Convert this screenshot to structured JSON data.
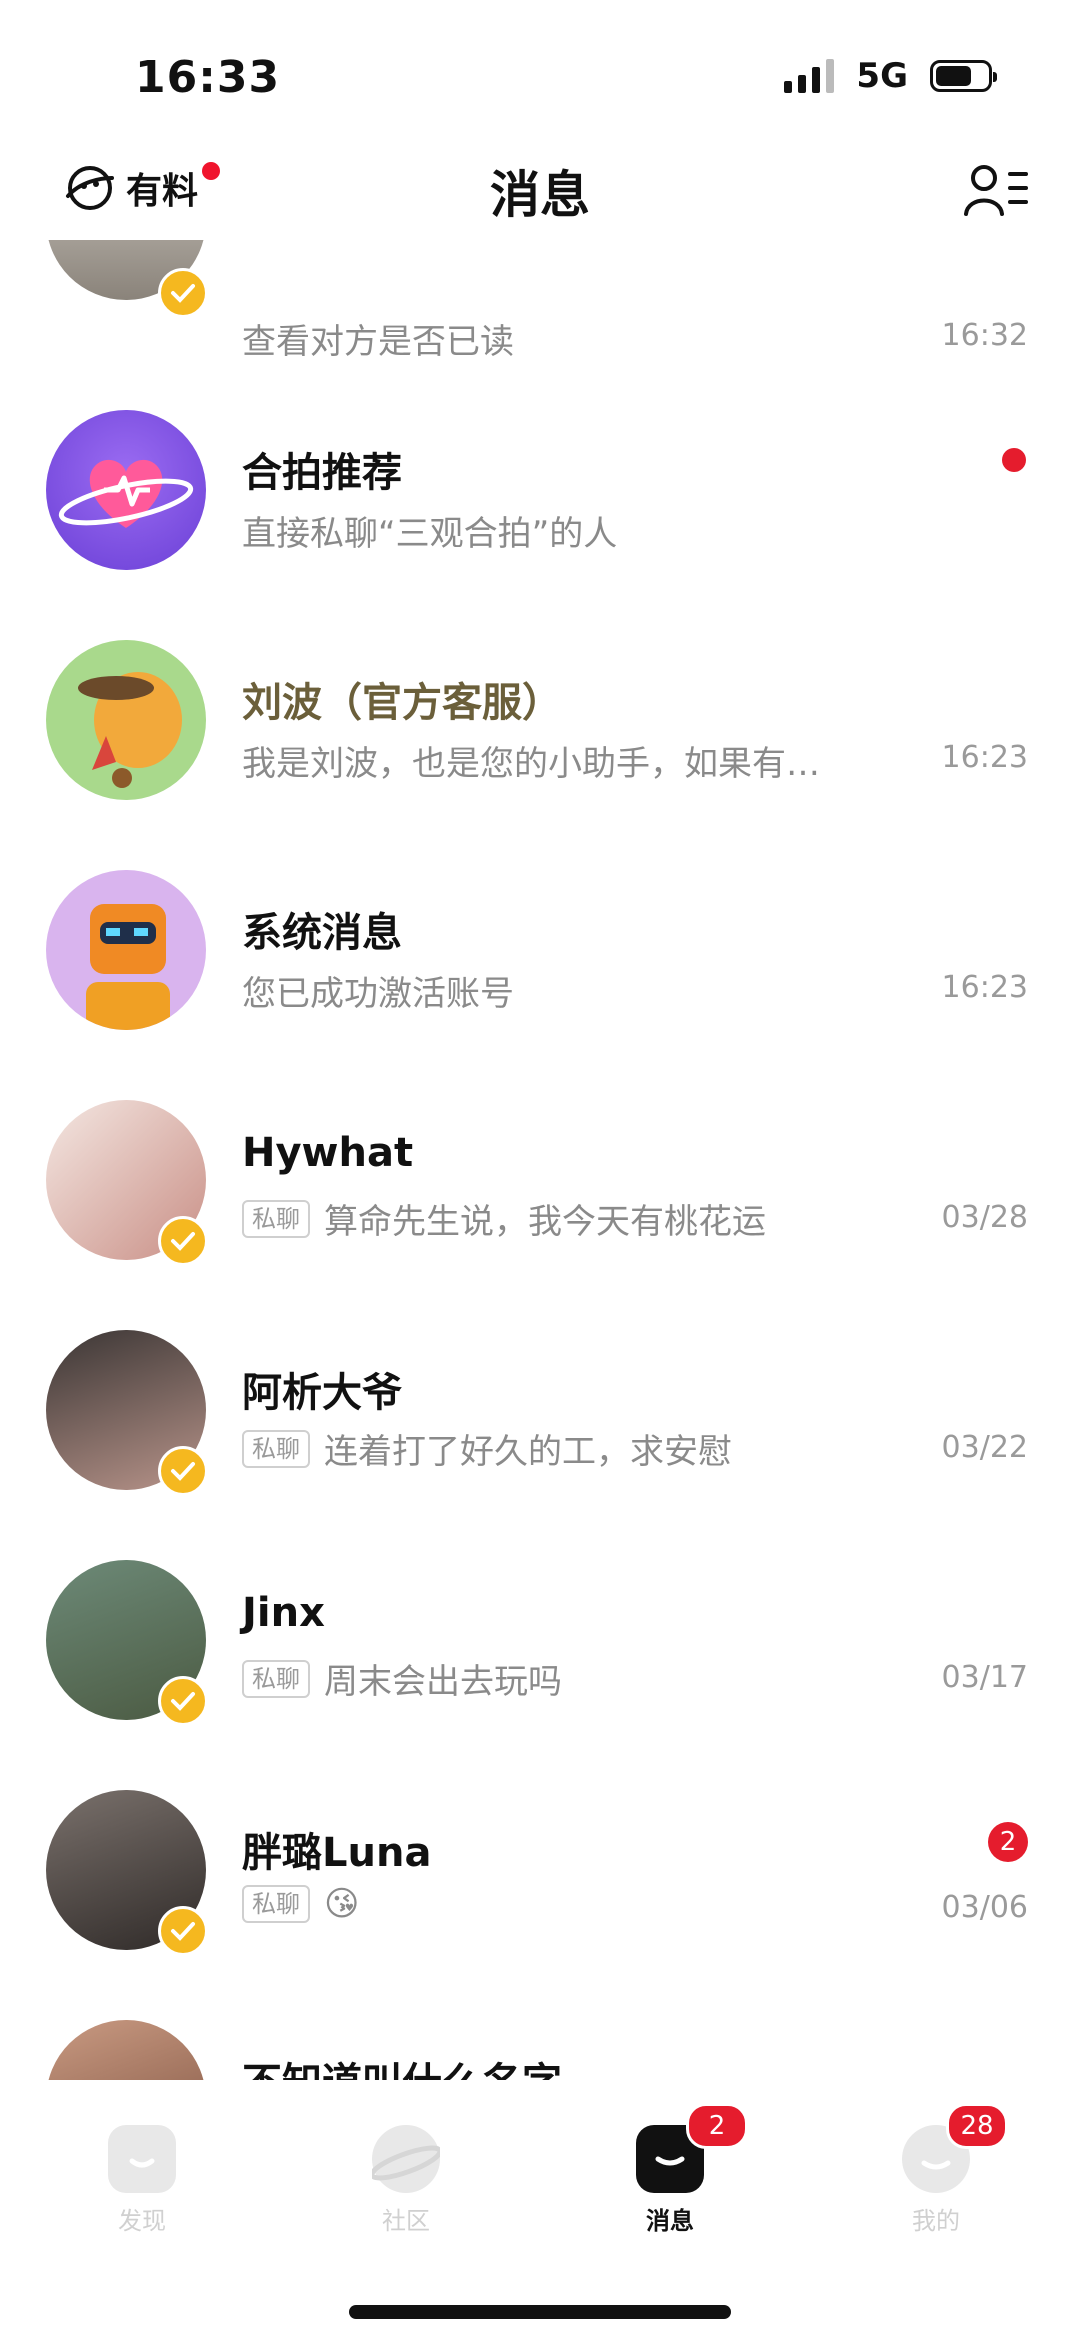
{
  "status": {
    "time": "16:33",
    "network": "5G"
  },
  "header": {
    "left_label": "有料",
    "title": "消息"
  },
  "messages": [
    {
      "name": "",
      "preview": "查看对方是否已读",
      "time": "16:32"
    },
    {
      "name": "合拍推荐",
      "preview": "直接私聊“三观合拍”的人",
      "time": ""
    },
    {
      "name": "刘波（官方客服）",
      "preview": "我是刘波，也是您的小助手，如果有…",
      "time": "16:23"
    },
    {
      "name": "系统消息",
      "preview": "您已成功激活账号",
      "time": "16:23"
    },
    {
      "name": "Hywhat",
      "tag": "私聊",
      "preview": "算命先生说，我今天有桃花运",
      "time": "03/28"
    },
    {
      "name": "阿析大爷",
      "tag": "私聊",
      "preview": "连着打了好久的工，求安慰",
      "time": "03/22"
    },
    {
      "name": "Jinx",
      "tag": "私聊",
      "preview": "周末会出去玩吗",
      "time": "03/17"
    },
    {
      "name": "胖璐Luna",
      "tag": "私聊",
      "preview": "😘",
      "time": "03/06",
      "unread": "2"
    },
    {
      "name": "不知道叫什么名字",
      "preview": "",
      "time": ""
    }
  ],
  "tabbar": {
    "tabs": [
      {
        "label": "发现"
      },
      {
        "label": "社区"
      },
      {
        "label": "消息",
        "badge": "2"
      },
      {
        "label": "我的",
        "badge": "28"
      }
    ]
  }
}
